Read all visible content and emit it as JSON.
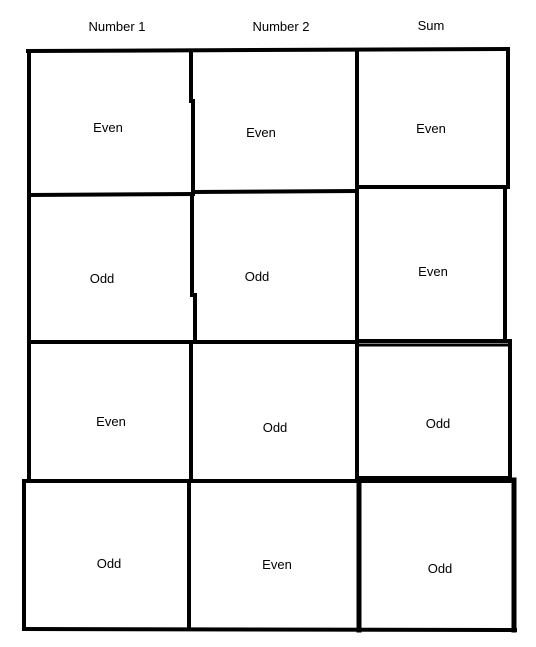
{
  "headers": [
    "Number 1",
    "Number 2",
    "Sum"
  ],
  "rows": [
    [
      "Even",
      "Even",
      "Even"
    ],
    [
      "Odd",
      "Odd",
      "Even"
    ],
    [
      "Even",
      "Odd",
      "Odd"
    ],
    [
      "Odd",
      "Even",
      "Odd"
    ]
  ]
}
